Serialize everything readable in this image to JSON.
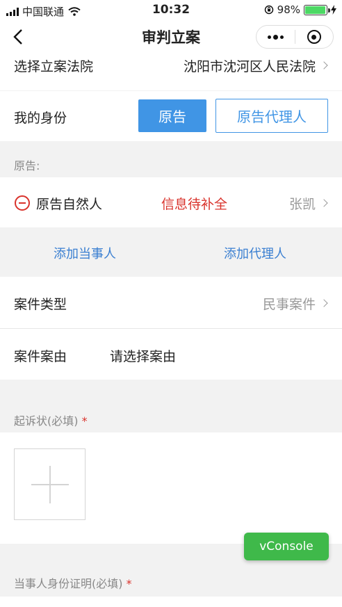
{
  "status_bar": {
    "carrier": "中国联通",
    "time": "10:32",
    "battery": "98%",
    "battery_level": 0.98
  },
  "nav": {
    "title": "审判立案",
    "back_icon": "chevron-left-icon",
    "more_icon": "more-dots-icon",
    "close_icon": "target-icon"
  },
  "court": {
    "label": "选择立案法院",
    "value": "沈阳市沈河区人民法院"
  },
  "identity": {
    "label": "我的身份",
    "options": [
      "原告",
      "原告代理人"
    ],
    "selected": "原告"
  },
  "plaintiff": {
    "section_label": "原告:",
    "type": "原告自然人",
    "status": "信息待补全",
    "name": "张凯"
  },
  "actions": {
    "add_party": "添加当事人",
    "add_agent": "添加代理人"
  },
  "case_type": {
    "label": "案件类型",
    "value": "民事案件"
  },
  "case_cause": {
    "label": "案件案由",
    "placeholder": "请选择案由"
  },
  "complaint": {
    "label": "起诉状(必填)",
    "required_mark": "*"
  },
  "id_proof": {
    "label": "当事人身份证明(必填)",
    "required_mark": "*"
  },
  "vconsole": {
    "label": "vConsole"
  },
  "colors": {
    "accent": "#4095e5",
    "danger": "#d9322b",
    "link": "#3a7fd1",
    "vconsole": "#3fb94a",
    "background": "#f2f2f2"
  }
}
